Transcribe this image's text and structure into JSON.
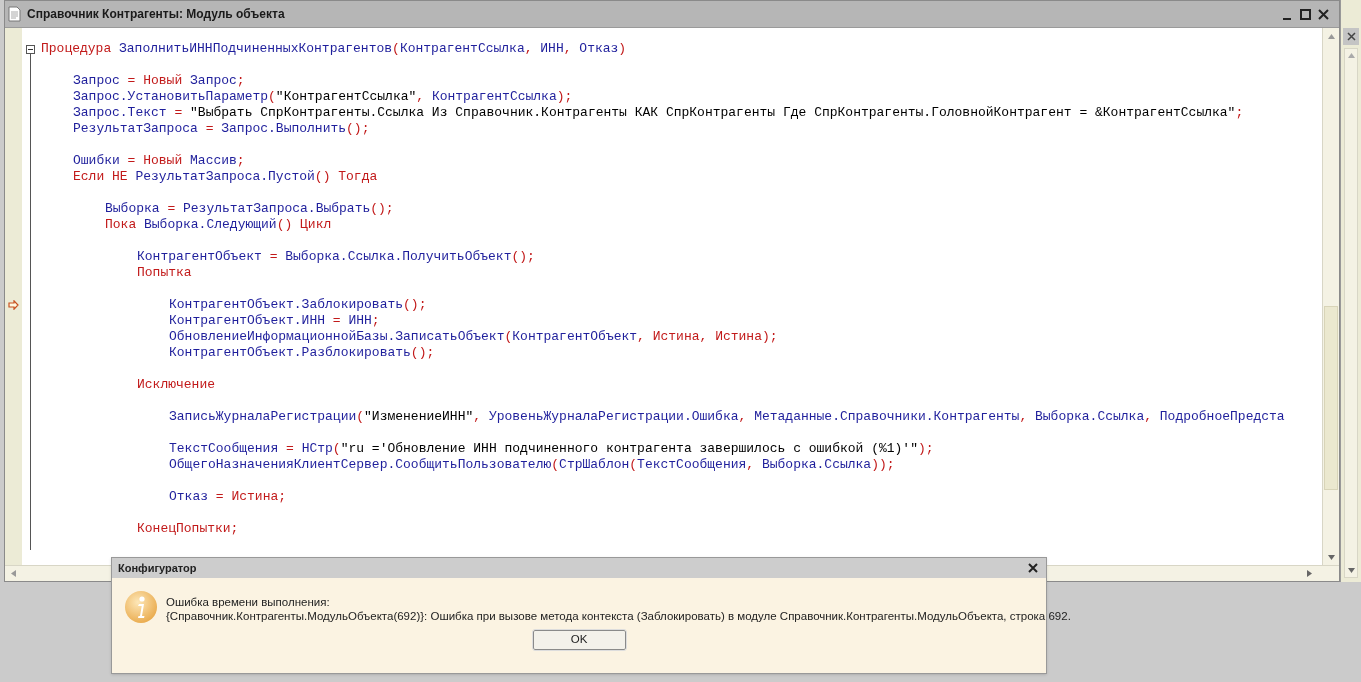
{
  "window": {
    "title": "Справочник Контрагенты: Модуль объекта"
  },
  "editor": {
    "lines": [
      {
        "kind": "procedure",
        "current": false,
        "tokens": [
          {
            "kind": "kw",
            "t": "Процедура "
          },
          {
            "kind": "id",
            "t": "ЗаполнитьИННПодчиненныхКонтрагентов"
          },
          {
            "kind": "p",
            "t": "("
          },
          {
            "kind": "id",
            "t": "КонтрагентСсылка"
          },
          {
            "kind": "p",
            "t": ", "
          },
          {
            "kind": "id",
            "t": "ИНН"
          },
          {
            "kind": "p",
            "t": ", "
          },
          {
            "kind": "id",
            "t": "Отказ"
          },
          {
            "kind": "p",
            "t": ")"
          }
        ],
        "children": [
          {
            "kind": "blank"
          },
          {
            "kind": "code",
            "current": false,
            "tokens": [
              {
                "kind": "id",
                "t": "Запрос"
              },
              {
                "kind": "p",
                "t": " = "
              },
              {
                "kind": "kw",
                "t": "Новый"
              },
              {
                "kind": "id",
                "t": " Запрос"
              },
              {
                "kind": "p",
                "t": ";"
              }
            ]
          },
          {
            "kind": "code",
            "current": false,
            "tokens": [
              {
                "kind": "id",
                "t": "Запрос.УстановитьПараметр"
              },
              {
                "kind": "p",
                "t": "("
              },
              {
                "kind": "s",
                "t": "\"КонтрагентСсылка\""
              },
              {
                "kind": "p",
                "t": ", "
              },
              {
                "kind": "id",
                "t": "КонтрагентСсылка"
              },
              {
                "kind": "p",
                "t": ");"
              }
            ]
          },
          {
            "kind": "code",
            "current": false,
            "tokens": [
              {
                "kind": "id",
                "t": "Запрос.Текст"
              },
              {
                "kind": "p",
                "t": " = "
              },
              {
                "kind": "s",
                "t": "\"Выбрать СпрКонтрагенты.Ссылка Из Справочник.Контрагенты КАК СпрКонтрагенты Где СпрКонтрагенты.ГоловнойКонтрагент = &КонтрагентСсылка\""
              },
              {
                "kind": "p",
                "t": ";"
              }
            ]
          },
          {
            "kind": "code",
            "current": false,
            "tokens": [
              {
                "kind": "id",
                "t": "РезультатЗапроса"
              },
              {
                "kind": "p",
                "t": " = "
              },
              {
                "kind": "id",
                "t": "Запрос.Выполнить"
              },
              {
                "kind": "p",
                "t": "();"
              }
            ]
          },
          {
            "kind": "blank"
          },
          {
            "kind": "code",
            "current": false,
            "tokens": [
              {
                "kind": "id",
                "t": "Ошибки"
              },
              {
                "kind": "p",
                "t": " = "
              },
              {
                "kind": "kw",
                "t": "Новый"
              },
              {
                "kind": "id",
                "t": " Массив"
              },
              {
                "kind": "p",
                "t": ";"
              }
            ]
          },
          {
            "kind": "code",
            "current": false,
            "tokens": [
              {
                "kind": "kw",
                "t": "Если НЕ "
              },
              {
                "kind": "id",
                "t": "РезультатЗапроса.Пустой"
              },
              {
                "kind": "p",
                "t": "() "
              },
              {
                "kind": "kw",
                "t": "Тогда"
              }
            ],
            "children": [
              {
                "kind": "blank"
              },
              {
                "kind": "code",
                "current": false,
                "tokens": [
                  {
                    "kind": "id",
                    "t": "Выборка"
                  },
                  {
                    "kind": "p",
                    "t": " = "
                  },
                  {
                    "kind": "id",
                    "t": "РезультатЗапроса.Выбрать"
                  },
                  {
                    "kind": "p",
                    "t": "();"
                  }
                ]
              },
              {
                "kind": "code",
                "current": false,
                "tokens": [
                  {
                    "kind": "kw",
                    "t": "Пока "
                  },
                  {
                    "kind": "id",
                    "t": "Выборка.Следующий"
                  },
                  {
                    "kind": "p",
                    "t": "() "
                  },
                  {
                    "kind": "kw",
                    "t": "Цикл"
                  }
                ],
                "children": [
                  {
                    "kind": "blank"
                  },
                  {
                    "kind": "code",
                    "current": false,
                    "tokens": [
                      {
                        "kind": "id",
                        "t": "КонтрагентОбъект"
                      },
                      {
                        "kind": "p",
                        "t": " = "
                      },
                      {
                        "kind": "id",
                        "t": "Выборка.Ссылка.ПолучитьОбъект"
                      },
                      {
                        "kind": "p",
                        "t": "();"
                      }
                    ]
                  },
                  {
                    "kind": "code",
                    "current": false,
                    "tokens": [
                      {
                        "kind": "kw",
                        "t": "Попытка"
                      }
                    ],
                    "children": [
                      {
                        "kind": "blank"
                      },
                      {
                        "kind": "code",
                        "current": true,
                        "tokens": [
                          {
                            "kind": "id",
                            "t": "КонтрагентОбъект.Заблокировать"
                          },
                          {
                            "kind": "p",
                            "t": "();"
                          }
                        ]
                      },
                      {
                        "kind": "code",
                        "current": false,
                        "tokens": [
                          {
                            "kind": "id",
                            "t": "КонтрагентОбъект.ИНН"
                          },
                          {
                            "kind": "p",
                            "t": " = "
                          },
                          {
                            "kind": "id",
                            "t": "ИНН"
                          },
                          {
                            "kind": "p",
                            "t": ";"
                          }
                        ]
                      },
                      {
                        "kind": "code",
                        "current": false,
                        "tokens": [
                          {
                            "kind": "id",
                            "t": "ОбновлениеИнформационнойБазы.ЗаписатьОбъект"
                          },
                          {
                            "kind": "p",
                            "t": "("
                          },
                          {
                            "kind": "id",
                            "t": "КонтрагентОбъект"
                          },
                          {
                            "kind": "p",
                            "t": ", "
                          },
                          {
                            "kind": "kw",
                            "t": "Истина"
                          },
                          {
                            "kind": "p",
                            "t": ", "
                          },
                          {
                            "kind": "kw",
                            "t": "Истина"
                          },
                          {
                            "kind": "p",
                            "t": ");"
                          }
                        ]
                      },
                      {
                        "kind": "code",
                        "current": false,
                        "tokens": [
                          {
                            "kind": "id",
                            "t": "КонтрагентОбъект.Разблокировать"
                          },
                          {
                            "kind": "p",
                            "t": "();"
                          }
                        ]
                      },
                      {
                        "kind": "blank"
                      }
                    ]
                  },
                  {
                    "kind": "code",
                    "current": false,
                    "tokens": [
                      {
                        "kind": "kw",
                        "t": "Исключение"
                      }
                    ],
                    "children": [
                      {
                        "kind": "blank"
                      },
                      {
                        "kind": "code",
                        "current": false,
                        "tokens": [
                          {
                            "kind": "id",
                            "t": "ЗаписьЖурналаРегистрации"
                          },
                          {
                            "kind": "p",
                            "t": "("
                          },
                          {
                            "kind": "s",
                            "t": "\"ИзменениеИНН\""
                          },
                          {
                            "kind": "p",
                            "t": ", "
                          },
                          {
                            "kind": "id",
                            "t": "УровеньЖурналаРегистрации.Ошибка"
                          },
                          {
                            "kind": "p",
                            "t": ", "
                          },
                          {
                            "kind": "id",
                            "t": "Метаданные.Справочники.Контрагенты"
                          },
                          {
                            "kind": "p",
                            "t": ", "
                          },
                          {
                            "kind": "id",
                            "t": "Выборка.Ссылка"
                          },
                          {
                            "kind": "p",
                            "t": ", "
                          },
                          {
                            "kind": "id",
                            "t": "ПодробноеПредста"
                          }
                        ]
                      },
                      {
                        "kind": "blank"
                      },
                      {
                        "kind": "code",
                        "current": false,
                        "tokens": [
                          {
                            "kind": "id",
                            "t": "ТекстСообщения"
                          },
                          {
                            "kind": "p",
                            "t": " = "
                          },
                          {
                            "kind": "id",
                            "t": "НСтр"
                          },
                          {
                            "kind": "p",
                            "t": "("
                          },
                          {
                            "kind": "s",
                            "t": "\"ru ='Обновление ИНН подчиненного контрагента завершилось с ошибкой (%1)'\""
                          },
                          {
                            "kind": "p",
                            "t": ");"
                          }
                        ]
                      },
                      {
                        "kind": "code",
                        "current": false,
                        "tokens": [
                          {
                            "kind": "id",
                            "t": "ОбщегоНазначенияКлиентСервер.СообщитьПользователю"
                          },
                          {
                            "kind": "p",
                            "t": "("
                          },
                          {
                            "kind": "id",
                            "t": "СтрШаблон"
                          },
                          {
                            "kind": "p",
                            "t": "("
                          },
                          {
                            "kind": "id",
                            "t": "ТекстСообщения"
                          },
                          {
                            "kind": "p",
                            "t": ", "
                          },
                          {
                            "kind": "id",
                            "t": "Выборка.Ссылка"
                          },
                          {
                            "kind": "p",
                            "t": "));"
                          }
                        ]
                      },
                      {
                        "kind": "blank"
                      },
                      {
                        "kind": "code",
                        "current": false,
                        "tokens": [
                          {
                            "kind": "id",
                            "t": "Отказ"
                          },
                          {
                            "kind": "p",
                            "t": " = "
                          },
                          {
                            "kind": "kw",
                            "t": "Истина"
                          },
                          {
                            "kind": "p",
                            "t": ";"
                          }
                        ]
                      },
                      {
                        "kind": "blank"
                      }
                    ]
                  },
                  {
                    "kind": "code",
                    "current": false,
                    "tokens": [
                      {
                        "kind": "kw",
                        "t": "КонецПопытки;"
                      }
                    ]
                  }
                ]
              }
            ]
          }
        ]
      }
    ]
  },
  "dialog": {
    "title": "Конфигуратор",
    "heading": "Ошибка времени выполнения:",
    "message": "{Справочник.Контрагенты.МодульОбъекта(692)}: Ошибка при вызове метода контекста (Заблокировать) в модуле Справочник.Контрагенты.МодульОбъекта, строка 692.",
    "buttons": [
      "OK"
    ]
  }
}
